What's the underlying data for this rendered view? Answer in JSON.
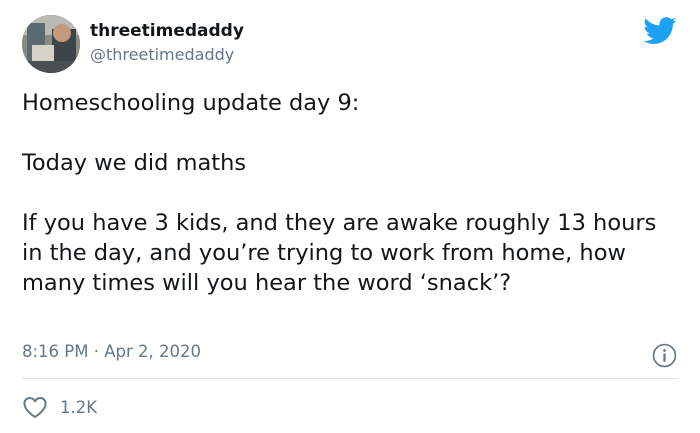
{
  "tweet": {
    "display_name": "threetimedaddy",
    "handle": "@threetimedaddy",
    "paragraphs": [
      "Homeschooling update day 9:",
      "Today we did maths",
      "If you have 3 kids, and they are awake roughly 13 hours in the day, and you’re trying to work from home, how many times will you hear the word ‘snack’?"
    ],
    "time": "8:16 PM",
    "separator": "·",
    "date": "Apr 2, 2020",
    "like_count": "1.2K"
  },
  "icons": {
    "brand": "twitter-bird-icon",
    "info": "info-icon",
    "like": "heart-icon"
  },
  "colors": {
    "brand_blue": "#1da1f2",
    "secondary_text": "#657786",
    "primary_text": "#14171a",
    "divider": "#dce1e5"
  }
}
